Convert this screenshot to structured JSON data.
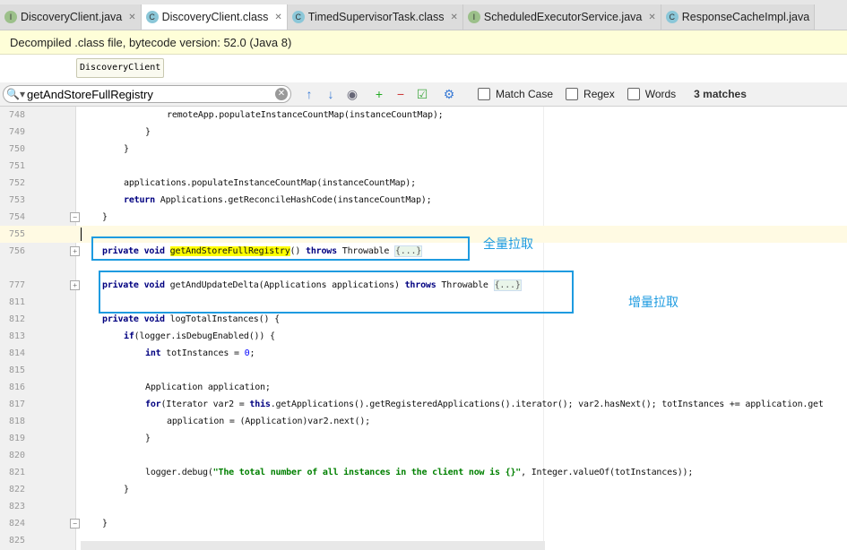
{
  "tabs": [
    {
      "label": "DiscoveryClient.java",
      "type": "I",
      "active": false
    },
    {
      "label": "DiscoveryClient.class",
      "type": "C",
      "active": true
    },
    {
      "label": "TimedSupervisorTask.class",
      "type": "C",
      "active": false
    },
    {
      "label": "ScheduledExecutorService.java",
      "type": "I",
      "active": false
    },
    {
      "label": "ResponseCacheImpl.java",
      "type": "C",
      "active": false
    }
  ],
  "banner": "Decompiled .class file, bytecode version: 52.0 (Java 8)",
  "breadcrumb": "DiscoveryClient",
  "search": {
    "value": "getAndStoreFullRegistry",
    "match_case": "Match Case",
    "regex": "Regex",
    "words": "Words",
    "matches": "3 matches"
  },
  "annotations": {
    "full": "全量拉取",
    "delta": "增量拉取"
  },
  "lines": [
    {
      "n": "748",
      "i": 4,
      "s": [
        {
          "t": "remoteApp.populateInstanceCountMap(instanceCountMap);"
        }
      ]
    },
    {
      "n": "749",
      "i": 3,
      "s": [
        {
          "t": "}"
        }
      ]
    },
    {
      "n": "750",
      "i": 2,
      "s": [
        {
          "t": "}"
        }
      ]
    },
    {
      "n": "751",
      "i": 0,
      "s": []
    },
    {
      "n": "752",
      "i": 2,
      "s": [
        {
          "t": "applications.populateInstanceCountMap(instanceCountMap);"
        }
      ]
    },
    {
      "n": "753",
      "i": 2,
      "s": [
        {
          "t": "return",
          "c": "kw"
        },
        {
          "t": " Applications.getReconcileHashCode(instanceCountMap);"
        }
      ]
    },
    {
      "n": "754",
      "i": 1,
      "s": [
        {
          "t": "}"
        }
      ]
    },
    {
      "n": "755",
      "i": 0,
      "s": [],
      "cur": true
    },
    {
      "n": "756",
      "i": 1,
      "s": [
        {
          "t": "private void ",
          "c": "kw"
        },
        {
          "t": "getAndStoreFullRegistry",
          "c": "hl"
        },
        {
          "t": "() "
        },
        {
          "t": "throws",
          "c": "kw"
        },
        {
          "t": " Throwable "
        },
        {
          "t": "{...}",
          "c": "fold"
        }
      ]
    },
    {
      "n": "",
      "i": 0,
      "s": []
    },
    {
      "n": "777",
      "i": 1,
      "s": [
        {
          "t": "private void ",
          "c": "kw"
        },
        {
          "t": "getAndUpdateDelta(Applications applications) "
        },
        {
          "t": "throws",
          "c": "kw"
        },
        {
          "t": " Throwable "
        },
        {
          "t": "{...}",
          "c": "fold"
        }
      ]
    },
    {
      "n": "811",
      "i": 0,
      "s": []
    },
    {
      "n": "812",
      "i": 1,
      "s": [
        {
          "t": "private void ",
          "c": "kw"
        },
        {
          "t": "logTotalInstances() {"
        }
      ]
    },
    {
      "n": "813",
      "i": 2,
      "s": [
        {
          "t": "if",
          "c": "kw"
        },
        {
          "t": "(logger.isDebugEnabled()) {"
        }
      ]
    },
    {
      "n": "814",
      "i": 3,
      "s": [
        {
          "t": "int",
          "c": "kw"
        },
        {
          "t": " totInstances = "
        },
        {
          "t": "0",
          "c": "num"
        },
        {
          "t": ";"
        }
      ]
    },
    {
      "n": "815",
      "i": 0,
      "s": []
    },
    {
      "n": "816",
      "i": 3,
      "s": [
        {
          "t": "Application application;"
        }
      ]
    },
    {
      "n": "817",
      "i": 3,
      "s": [
        {
          "t": "for",
          "c": "kw"
        },
        {
          "t": "(Iterator var2 = "
        },
        {
          "t": "this",
          "c": "kw"
        },
        {
          "t": ".getApplications().getRegisteredApplications().iterator(); var2.hasNext(); totInstances += application.get"
        }
      ]
    },
    {
      "n": "818",
      "i": 4,
      "s": [
        {
          "t": "application = (Application)var2.next();"
        }
      ]
    },
    {
      "n": "819",
      "i": 3,
      "s": [
        {
          "t": "}"
        }
      ]
    },
    {
      "n": "820",
      "i": 0,
      "s": []
    },
    {
      "n": "821",
      "i": 3,
      "s": [
        {
          "t": "logger.debug("
        },
        {
          "t": "\"The total number of all instances in the client now is {}\"",
          "c": "str"
        },
        {
          "t": ", Integer.valueOf(totInstances));"
        }
      ]
    },
    {
      "n": "822",
      "i": 2,
      "s": [
        {
          "t": "}"
        }
      ]
    },
    {
      "n": "823",
      "i": 0,
      "s": []
    },
    {
      "n": "824",
      "i": 1,
      "s": [
        {
          "t": "}"
        }
      ]
    },
    {
      "n": "825",
      "i": 0,
      "s": []
    }
  ]
}
